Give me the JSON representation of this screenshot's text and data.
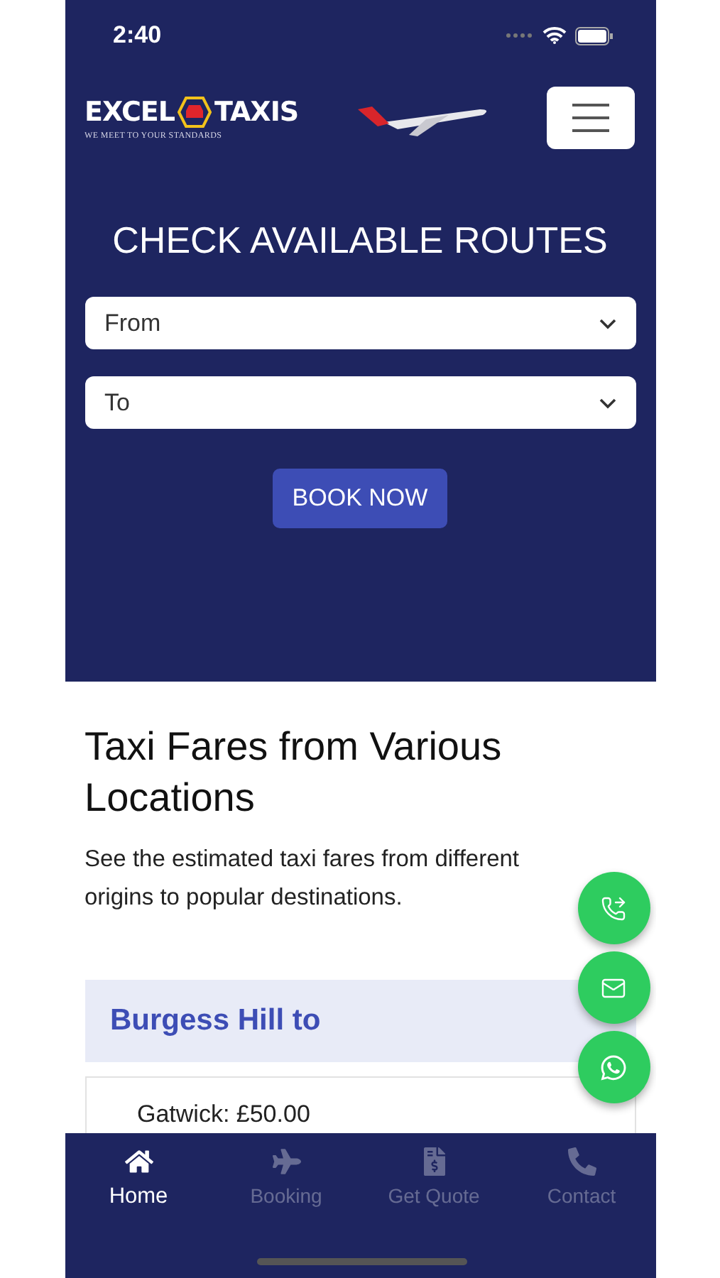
{
  "status_bar": {
    "time": "2:40"
  },
  "header": {
    "logo": {
      "word_1": "EXCEL",
      "word_2": "TAXIS",
      "tagline": "WE MEET TO YOUR STANDARDS"
    }
  },
  "booking_form": {
    "title": "CHECK AVAILABLE ROUTES",
    "selects": [
      {
        "placeholder": "From"
      },
      {
        "placeholder": "To"
      }
    ],
    "button": "BOOK NOW"
  },
  "fares": {
    "heading": "Taxi Fares from Various Locations",
    "description": "See the estimated taxi fares from different origins to popular destinations.",
    "card": {
      "title": "Burgess Hill to",
      "items": [
        "Gatwick: £50.00"
      ]
    }
  },
  "floating_buttons": [
    {
      "kind": "call"
    },
    {
      "kind": "email"
    },
    {
      "kind": "whatsapp"
    }
  ],
  "bottom_nav": [
    {
      "label": "Home",
      "kind": "home",
      "selected": true
    },
    {
      "label": "Booking",
      "kind": "plane",
      "selected": false
    },
    {
      "label": "Get Quote",
      "kind": "quote",
      "selected": false
    },
    {
      "label": "Contact",
      "kind": "phone",
      "selected": false
    }
  ]
}
